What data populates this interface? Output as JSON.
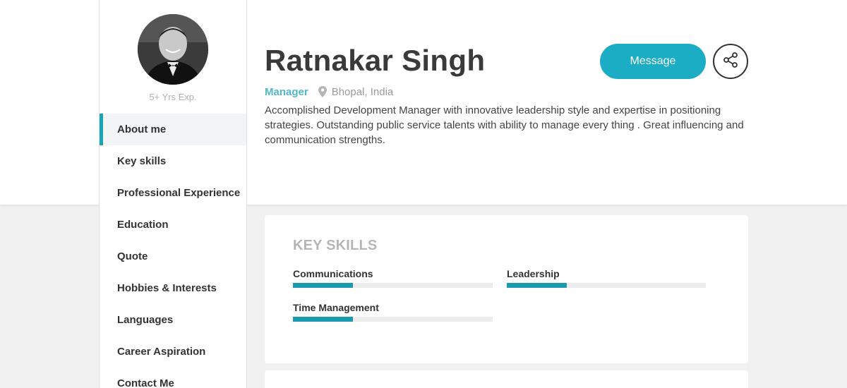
{
  "profile": {
    "experience": "5+ Yrs Exp.",
    "name": "Ratnakar Singh",
    "role": "Manager",
    "location": "Bhopal, India",
    "bio": "Accomplished Development Manager with innovative leadership style and expertise in positioning strategies. Outstanding public service talents with ability to manage every thing . Great influencing and communication strengths."
  },
  "actions": {
    "message_label": "Message"
  },
  "nav": {
    "items": [
      {
        "label": "About me",
        "active": true
      },
      {
        "label": "Key skills"
      },
      {
        "label": "Professional Experience"
      },
      {
        "label": "Education"
      },
      {
        "label": "Quote"
      },
      {
        "label": "Hobbies & Interests"
      },
      {
        "label": "Languages"
      },
      {
        "label": "Career Aspiration"
      },
      {
        "label": "Contact Me"
      }
    ]
  },
  "key_skills": {
    "title": "KEY SKILLS",
    "items": [
      {
        "name": "Communications",
        "level": 0.3
      },
      {
        "name": "Leadership",
        "level": 0.3
      },
      {
        "name": "Time Management",
        "level": 0.3
      }
    ]
  },
  "colors": {
    "accent": "#1aadc4",
    "skill_fill": "#1a9aad",
    "role_text": "#4fb8c8"
  },
  "icons": {
    "location": "map-pin-icon",
    "share": "share-icon"
  }
}
